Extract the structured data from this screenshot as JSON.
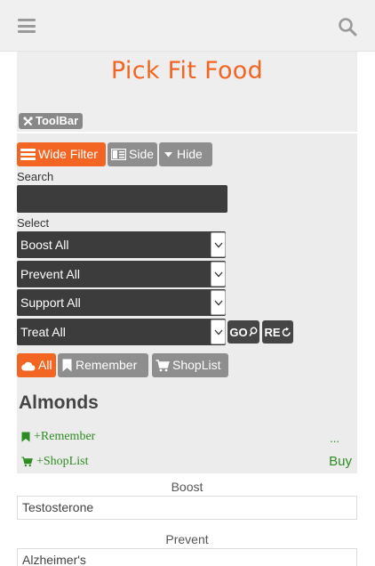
{
  "topbar": {
    "menu_icon": "hamburger-menu-icon",
    "search_icon": "search-icon"
  },
  "header": {
    "title": "Pick Fit Food",
    "toolbar_label": "ToolBar",
    "toolbar_icon": "tools-icon"
  },
  "filter_tabs": [
    {
      "label": "Wide Filter",
      "icon": "list-icon",
      "active": true
    },
    {
      "label": "Side",
      "icon": "sidebar-icon",
      "active": false
    },
    {
      "label": "Hide",
      "icon": "caret-down-icon",
      "active": false
    }
  ],
  "search": {
    "label": "Search",
    "value": "",
    "placeholder": ""
  },
  "select": {
    "label": "Select",
    "dropdowns": [
      "Boost All",
      "Prevent All",
      "Support All",
      "Treat All"
    ]
  },
  "actions": {
    "go_label": "GO",
    "reset_label": "RE"
  },
  "view_tabs": [
    {
      "label": "All",
      "icon": "cloud-icon",
      "active": true
    },
    {
      "label": "Remember",
      "icon": "bookmark-icon",
      "active": false
    },
    {
      "label": "ShopList",
      "icon": "cart-icon",
      "active": false
    }
  ],
  "food": {
    "name": "Almonds",
    "remember_label": "+Remember",
    "shoplist_label": "+ShopList",
    "more_label": "...",
    "buy_label": "Buy"
  },
  "categories": [
    {
      "label": "Boost",
      "value": "Testosterone"
    },
    {
      "label": "Prevent",
      "value": "Alzheimer's"
    }
  ],
  "colors": {
    "accent": "#f26522",
    "link_green": "#2e8b22",
    "dark_input": "#3c3c3c",
    "gray_button": "#8e8e8e"
  }
}
